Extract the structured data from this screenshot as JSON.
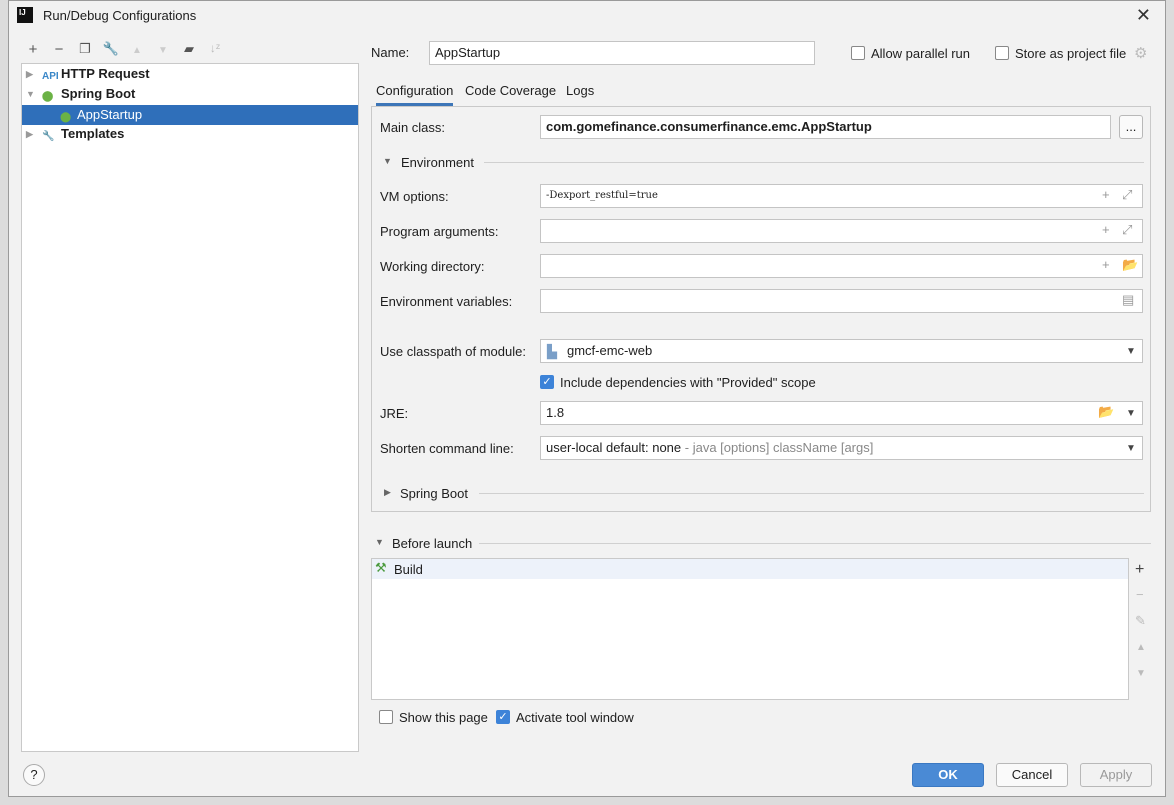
{
  "window": {
    "title": "Run/Debug Configurations",
    "logo": "IJ"
  },
  "toolbar": [
    "add-icon",
    "remove-icon",
    "copy-icon",
    "wrench-icon",
    "move-up-icon",
    "move-down-icon",
    "new-folder-icon",
    "sort-icon"
  ],
  "tree": {
    "items": [
      {
        "label": "HTTP Request",
        "icon": "api-icon"
      },
      {
        "label": "Spring Boot",
        "icon": "spring-boot-icon"
      },
      {
        "label": "AppStartup",
        "icon": "spring-boot-icon"
      },
      {
        "label": "Templates",
        "icon": "wrench-icon"
      }
    ]
  },
  "name": {
    "label": "Name:",
    "value": "AppStartup"
  },
  "allow_parallel": {
    "label": "Allow parallel run",
    "checked": false
  },
  "store_project": {
    "label": "Store as project file",
    "checked": false
  },
  "tabs": [
    "Configuration",
    "Code Coverage",
    "Logs"
  ],
  "form": {
    "main_class": {
      "label": "Main class:",
      "value": "com.gomefinance.consumerfinance.emc.AppStartup",
      "browse": "..."
    },
    "environment": "Environment",
    "vm_options": {
      "label": "VM options:",
      "value": "-Dexport_restful=true"
    },
    "program_args": {
      "label": "Program arguments:",
      "value": ""
    },
    "working_dir": {
      "label": "Working directory:",
      "value": ""
    },
    "env_vars": {
      "label": "Environment variables:",
      "value": ""
    },
    "classpath": {
      "label": "Use classpath of module:",
      "value": "gmcf-emc-web"
    },
    "include_provided": {
      "label": "Include dependencies with \"Provided\" scope",
      "checked": true
    },
    "jre": {
      "label": "JRE:",
      "value": "1.8"
    },
    "shorten": {
      "label": "Shorten command line:",
      "value": "user-local default: none",
      "hint": "- java [options] className [args]"
    },
    "spring_boot": "Spring Boot"
  },
  "before_launch": {
    "label": "Before launch",
    "items": [
      "Build"
    ]
  },
  "show_page": {
    "label": "Show this page",
    "checked": false
  },
  "activate_tool": {
    "label": "Activate tool window",
    "checked": true
  },
  "buttons": {
    "ok": "OK",
    "cancel": "Cancel",
    "apply": "Apply",
    "help": "?"
  },
  "colors": {
    "accent": "#2f6fba",
    "ok": "#4a8ad5"
  }
}
